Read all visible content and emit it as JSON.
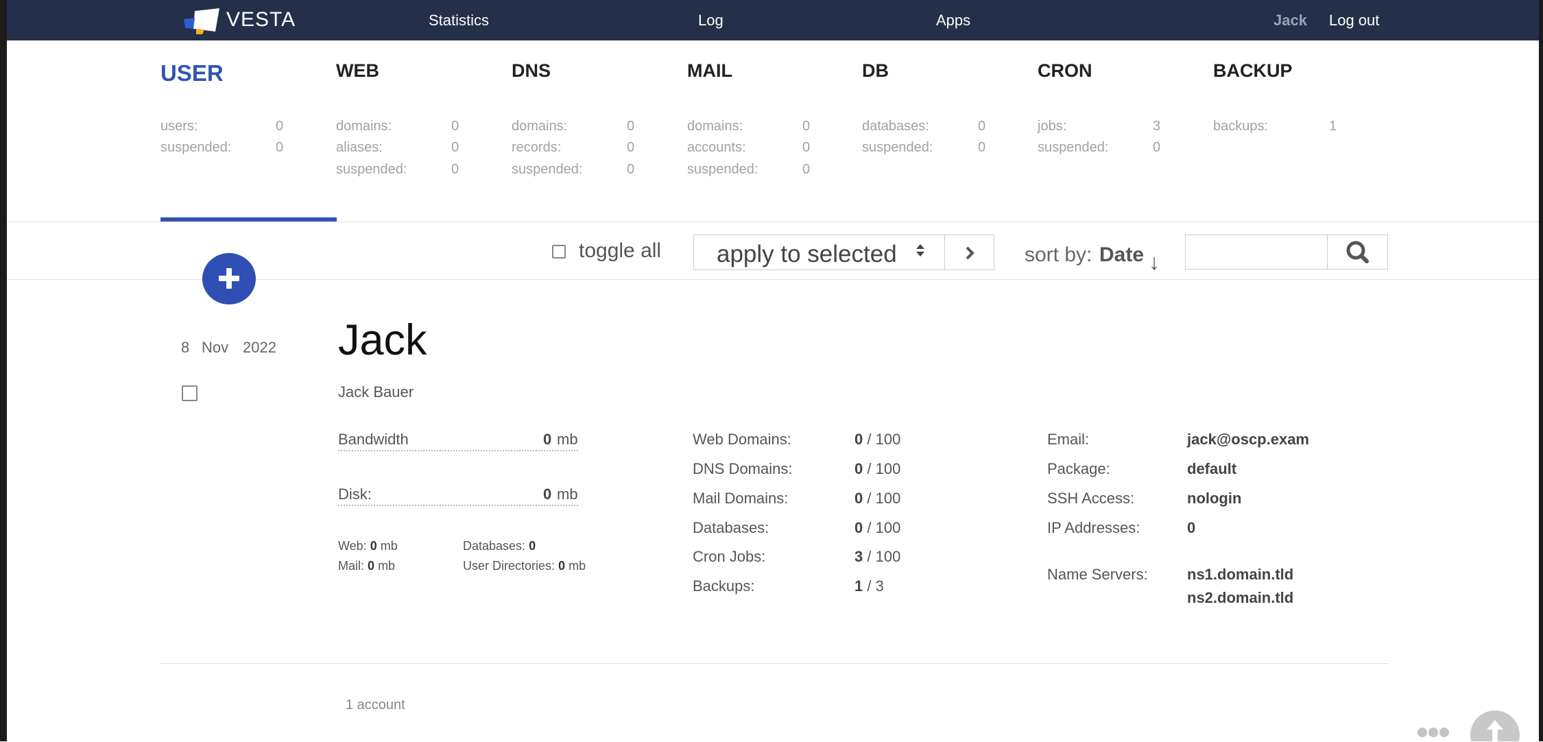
{
  "header": {
    "logo_text": "VESTA",
    "nav": {
      "statistics": "Statistics",
      "log": "Log",
      "apps": "Apps"
    },
    "user": "Jack",
    "logout": "Log out"
  },
  "tabs": [
    {
      "title": "USER",
      "active": true,
      "stats": [
        {
          "label": "users:",
          "value": "0"
        },
        {
          "label": "suspended:",
          "value": "0"
        }
      ]
    },
    {
      "title": "WEB",
      "stats": [
        {
          "label": "domains:",
          "value": "0"
        },
        {
          "label": "aliases:",
          "value": "0"
        },
        {
          "label": "suspended:",
          "value": "0"
        }
      ]
    },
    {
      "title": "DNS",
      "stats": [
        {
          "label": "domains:",
          "value": "0"
        },
        {
          "label": "records:",
          "value": "0"
        },
        {
          "label": "suspended:",
          "value": "0"
        }
      ]
    },
    {
      "title": "MAIL",
      "stats": [
        {
          "label": "domains:",
          "value": "0"
        },
        {
          "label": "accounts:",
          "value": "0"
        },
        {
          "label": "suspended:",
          "value": "0"
        }
      ]
    },
    {
      "title": "DB",
      "stats": [
        {
          "label": "databases:",
          "value": "0"
        },
        {
          "label": "suspended:",
          "value": "0"
        }
      ]
    },
    {
      "title": "CRON",
      "stats": [
        {
          "label": "jobs:",
          "value": "3"
        },
        {
          "label": "suspended:",
          "value": "0"
        }
      ]
    },
    {
      "title": "BACKUP",
      "stats": [
        {
          "label": "backups:",
          "value": "1"
        }
      ]
    }
  ],
  "toolbar": {
    "toggle_all": "toggle all",
    "apply_label": "apply to selected",
    "sort_prefix": "sort by:",
    "sort_field": "Date",
    "sort_arrow": "↓",
    "search_value": ""
  },
  "user_entry": {
    "date": {
      "day": "8",
      "month": "Nov",
      "year": "2022"
    },
    "username": "Jack",
    "fullname": "Jack Bauer",
    "bandwidth": {
      "label": "Bandwidth",
      "value": "0",
      "unit": "mb"
    },
    "disk": {
      "label": "Disk:",
      "value": "0",
      "unit": "mb"
    },
    "usage": {
      "web_label": "Web:",
      "web_value": "0",
      "web_unit": "mb",
      "mail_label": "Mail:",
      "mail_value": "0",
      "mail_unit": "mb",
      "db_label": "Databases:",
      "db_value": "0",
      "udir_label": "User Directories:",
      "udir_value": "0",
      "udir_unit": "mb"
    },
    "limits": [
      {
        "label": "Web Domains:",
        "used": "0",
        "total": "100"
      },
      {
        "label": "DNS Domains:",
        "used": "0",
        "total": "100"
      },
      {
        "label": "Mail Domains:",
        "used": "0",
        "total": "100"
      },
      {
        "label": "Databases:",
        "used": "0",
        "total": "100"
      },
      {
        "label": "Cron Jobs:",
        "used": "3",
        "total": "100"
      },
      {
        "label": "Backups:",
        "used": "1",
        "total": "3"
      }
    ],
    "info": [
      {
        "label": "Email:",
        "value": "jack@oscp.exam"
      },
      {
        "label": "Package:",
        "value": "default"
      },
      {
        "label": "SSH Access:",
        "value": "nologin"
      },
      {
        "label": "IP Addresses:",
        "value": "0"
      }
    ],
    "name_servers": {
      "label": "Name Servers:",
      "ns1": "ns1.domain.tld",
      "ns2": "ns2.domain.tld"
    }
  },
  "footer": {
    "count": "1 account"
  },
  "colors": {
    "header_bg": "#243049",
    "accent": "#3154b4"
  }
}
